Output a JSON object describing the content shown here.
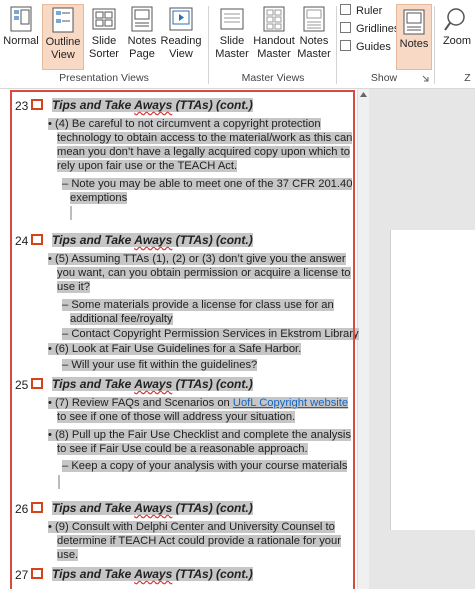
{
  "ribbon": {
    "views": [
      {
        "label": "Normal",
        "label2": ""
      },
      {
        "label": "Outline",
        "label2": "View"
      },
      {
        "label": "Slide",
        "label2": "Sorter"
      },
      {
        "label": "Notes",
        "label2": "Page"
      },
      {
        "label": "Reading",
        "label2": "View"
      }
    ],
    "masters": [
      {
        "label": "Slide",
        "label2": "Master"
      },
      {
        "label": "Handout",
        "label2": "Master"
      },
      {
        "label": "Notes",
        "label2": "Master"
      }
    ],
    "show": {
      "ruler": "Ruler",
      "gridlines": "Gridlines",
      "guides": "Guides"
    },
    "notes": "Notes",
    "zoom": "Zoom",
    "group_presentation_views": "Presentation Views",
    "group_master_views": "Master Views",
    "group_show": "Show",
    "group_zoom_partial": "Z"
  },
  "outline": {
    "slides": [
      {
        "num": "23",
        "title_a": "Tips and Take ",
        "title_b": "Aways",
        "title_c": " (TTAs) (cont.)",
        "lines": [
          "(4) Be careful to not circumvent a copyright protection",
          "technology to obtain access to the material/work as this can",
          "mean you don’t have a legally acquired copy upon which to",
          "rely upon fair use or the TEACH Act.",
          "Note you may be able to meet one of the 37 CFR 201.40",
          "exemptions"
        ]
      },
      {
        "num": "24",
        "title_a": "Tips and Take ",
        "title_b": "Aways",
        "title_c": " (TTAs) (cont.)",
        "lines": [
          "(5) Assuming TTAs (1), (2) or (3) don’t give you the answer",
          "you want, can you obtain permission or acquire a license to",
          "use it?",
          "Some materials provide a license for class use for an",
          "additional fee/royalty",
          "Contact Copyright Permission Services in Ekstrom Library",
          "(6)  Look at Fair Use Guidelines for a Safe Harbor.",
          "Will your use fit within the guidelines?"
        ]
      },
      {
        "num": "25",
        "title_a": "Tips and Take ",
        "title_b": "Aways",
        "title_c": " (TTAs) (cont.)",
        "lines": [
          "(7) Review FAQs and Scenarios on ",
          "UofL Copyright website",
          "to see if one of those will address your situation.",
          "(8) Pull up the Fair Use Checklist and complete the analysis",
          "to see if Fair Use could be a reasonable approach.",
          "Keep a copy of your analysis with your course materials"
        ]
      },
      {
        "num": "26",
        "title_a": "Tips and Take ",
        "title_b": "Aways",
        "title_c": " (TTAs) (cont.)",
        "lines": [
          "(9) Consult with Delphi Center and University Counsel  to",
          "determine if TEACH Act could provide a rationale for your",
          "use."
        ]
      },
      {
        "num": "27",
        "title_a": "Tips and Take ",
        "title_b": "Aways",
        "title_c": " (TTAs) (cont.)",
        "lines": []
      }
    ]
  }
}
